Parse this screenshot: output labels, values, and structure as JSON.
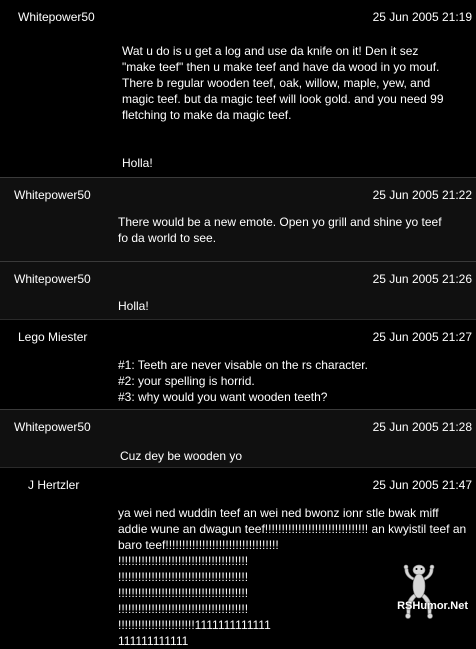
{
  "posts": [
    {
      "author": "Whitepower50",
      "date": "25 Jun 2005 21:19",
      "body": "Wat u do is u get a log and use da knife on it! Den it sez\n\"make teef\" then u make teef and have da wood in yo mouf.\nThere b regular wooden teef, oak, willow, maple, yew, and\nmagic teef. but da magic teef will look gold. and you need 99\nfletching to make da magic teef.\n\n\nHolla!"
    },
    {
      "author": "Whitepower50",
      "date": "25 Jun 2005 21:22",
      "body": "There would be a new emote. Open yo grill and shine yo teef\nfo da world to see."
    },
    {
      "author": "Whitepower50",
      "date": "25 Jun 2005 21:26",
      "body": "Holla!"
    },
    {
      "author": "Lego Miester",
      "date": "25 Jun 2005 21:27",
      "body": "#1: Teeth are never visable on the rs character.\n#2: your spelling is horrid.\n#3: why would you want wooden teeth?"
    },
    {
      "author": "Whitepower50",
      "date": "25 Jun 2005 21:28",
      "body": "Cuz dey be wooden yo"
    },
    {
      "author": "J Hertzler",
      "date": "25 Jun 2005 21:47",
      "body": "ya wei ned wuddin teef an wei ned bwonz ionr stle bwak miff\naddie wune an dwagun teef!!!!!!!!!!!!!!!!!!!!!!!!!!!!!!! an kwyistil teef an\nbaro teef!!!!!!!!!!!!!!!!!!!!!!!!!!!!!!!!!!\n!!!!!!!!!!!!!!!!!!!!!!!!!!!!!!!!!!!!!!!\n!!!!!!!!!!!!!!!!!!!!!!!!!!!!!!!!!!!!!!!\n!!!!!!!!!!!!!!!!!!!!!!!!!!!!!!!!!!!!!!!\n!!!!!!!!!!!!!!!!!!!!!!!!!!!!!!!!!!!!!!!\n!!!!!!!!!!!!!!!!!!!!!!!1111111111111\n111111111111"
    }
  ],
  "watermark": {
    "text": "RSHumor.Net",
    "icon": "frog-icon"
  }
}
